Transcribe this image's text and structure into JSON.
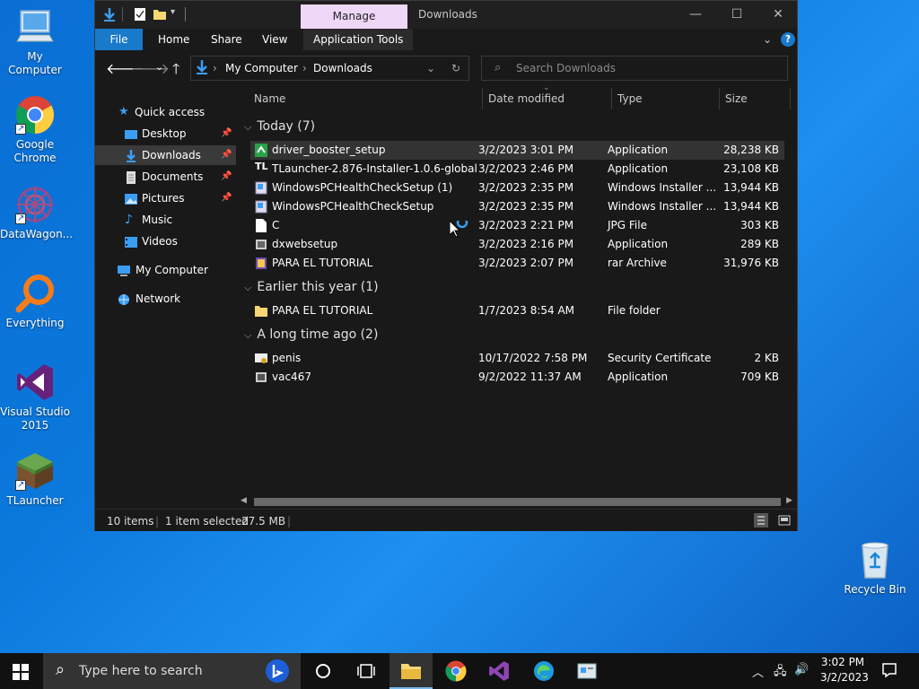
{
  "desktop": {
    "icons": [
      {
        "label": "My Computer"
      },
      {
        "label": "Google Chrome"
      },
      {
        "label": "DataWagon..."
      },
      {
        "label": "Everything"
      },
      {
        "label": "Visual Studio 2015"
      },
      {
        "label": "TLauncher"
      },
      {
        "label": "Recycle Bin"
      }
    ]
  },
  "window": {
    "manage_tab": "Manage",
    "title": "Downloads",
    "controls": {
      "minimize": "—",
      "maximize": "☐",
      "close": "✕"
    },
    "ribbon": {
      "file": "File",
      "home": "Home",
      "share": "Share",
      "view": "View",
      "application_tools": "Application Tools"
    },
    "address": {
      "crumb_root": "My Computer",
      "crumb_current": "Downloads"
    },
    "search": {
      "placeholder": "Search Downloads"
    },
    "nav": {
      "quick_access": "Quick access",
      "desktop": "Desktop",
      "downloads": "Downloads",
      "documents": "Documents",
      "pictures": "Pictures",
      "music": "Music",
      "videos": "Videos",
      "my_computer": "My Computer",
      "network": "Network"
    },
    "columns": {
      "name": "Name",
      "date": "Date modified",
      "type": "Type",
      "size": "Size"
    },
    "groups": [
      {
        "header": "Today (7)"
      },
      {
        "header": "Earlier this year (1)"
      },
      {
        "header": "A long time ago (2)"
      }
    ],
    "files": [
      {
        "name": "driver_booster_setup",
        "date": "3/2/2023 3:01 PM",
        "type": "Application",
        "size": "28,238 KB"
      },
      {
        "name": "TLauncher-2.876-Installer-1.0.6-global",
        "date": "3/2/2023 2:46 PM",
        "type": "Application",
        "size": "23,108 KB"
      },
      {
        "name": "WindowsPCHealthCheckSetup (1)",
        "date": "3/2/2023 2:35 PM",
        "type": "Windows Installer ...",
        "size": "13,944 KB"
      },
      {
        "name": "WindowsPCHealthCheckSetup",
        "date": "3/2/2023 2:35 PM",
        "type": "Windows Installer ...",
        "size": "13,944 KB"
      },
      {
        "name": "C",
        "date": "3/2/2023 2:21 PM",
        "type": "JPG File",
        "size": "303 KB"
      },
      {
        "name": "dxwebsetup",
        "date": "3/2/2023 2:16 PM",
        "type": "Application",
        "size": "289 KB"
      },
      {
        "name": "PARA EL TUTORIAL",
        "date": "3/2/2023 2:07 PM",
        "type": "rar Archive",
        "size": "31,976 KB"
      },
      {
        "name": "PARA EL TUTORIAL",
        "date": "1/7/2023 8:54 AM",
        "type": "File folder",
        "size": ""
      },
      {
        "name": "penis",
        "date": "10/17/2022 7:58 PM",
        "type": "Security Certificate",
        "size": "2 KB"
      },
      {
        "name": "vac467",
        "date": "9/2/2022 11:37 AM",
        "type": "Application",
        "size": "709 KB"
      }
    ],
    "status": {
      "items": "10 items",
      "selected": "1 item selected",
      "size": "27.5 MB"
    }
  },
  "taskbar": {
    "search_placeholder": "Type here to search",
    "time": "3:02 PM",
    "date": "3/2/2023"
  },
  "colors": {
    "accent": "#1979ca",
    "manage_tab": "#eed7f7",
    "window_bg": "#191919"
  }
}
